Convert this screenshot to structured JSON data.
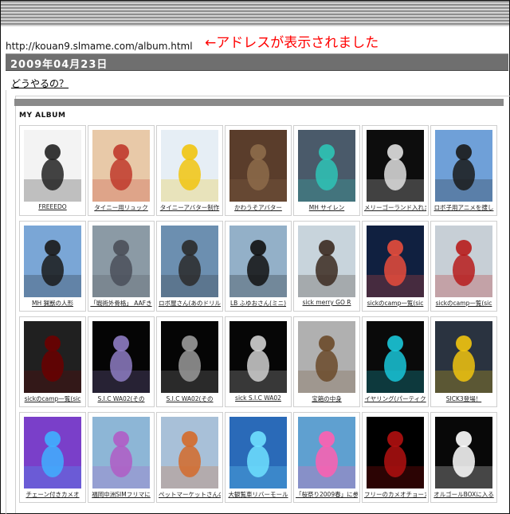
{
  "page": {
    "url": "http://kouan9.slmame.com/album.html",
    "annotation": "←アドレスが表示されました",
    "date": "2009年04月23日",
    "howto_link": "どうやるの？",
    "album_title": "MY ALBUM"
  },
  "album": {
    "rows": [
      [
        {
          "caption": "FREEEDO",
          "bg": "#f3f3f3",
          "accent": "#222222"
        },
        {
          "caption": "タイニー用リュック",
          "bg": "#e8c9a8",
          "accent": "#c0392b"
        },
        {
          "caption": "タイニーアバター制作",
          "bg": "#e6eef5",
          "accent": "#f1c40f"
        },
        {
          "caption": "かわうそアバター",
          "bg": "#5a3d2b",
          "accent": "#8d6b4a"
        },
        {
          "caption": "MH サイレン",
          "bg": "#4a5a6a",
          "accent": "#2ec4b6"
        },
        {
          "caption": "メリーゴーランド入れま",
          "bg": "#0d0d0d",
          "accent": "#e0e0e0"
        },
        {
          "caption": "ロボ子用アニメを捜し",
          "bg": "#6fa0d8",
          "accent": "#1a1a1a"
        }
      ],
      [
        {
          "caption": "MH 猟獣の人形",
          "bg": "#7aa6d6",
          "accent": "#1a1a1a"
        },
        {
          "caption": "「戦術外骨格」 AAFき",
          "bg": "#8b9aa5",
          "accent": "#4a4f59"
        },
        {
          "caption": "ロボ屋さん(あのドリル",
          "bg": "#6c8fb0",
          "accent": "#2a2a2a"
        },
        {
          "caption": "LB ふゆおさん(ミニ)",
          "bg": "#93b0c8",
          "accent": "#111111"
        },
        {
          "caption": "sick merry GO R",
          "bg": "#c8d4dc",
          "accent": "#3b2a20"
        },
        {
          "caption": "sickのcamp一覧(sic",
          "bg": "#102040",
          "accent": "#e74c3c"
        },
        {
          "caption": "sickのcamp一覧(sic",
          "bg": "#c7cfd6",
          "accent": "#b71c1c"
        }
      ],
      [
        {
          "caption": "sickのcamp一覧(sic",
          "bg": "#202020",
          "accent": "#6b0000"
        },
        {
          "caption": "S.I.C WA02(その",
          "bg": "#050505",
          "accent": "#8e7cc3"
        },
        {
          "caption": "S.I.C WA02(その",
          "bg": "#050505",
          "accent": "#9a9a9a"
        },
        {
          "caption": "sick S.I.C WA02",
          "bg": "#060606",
          "accent": "#d0d0d0"
        },
        {
          "caption": "宝箱の中身",
          "bg": "#b0b0b0",
          "accent": "#6b4a2a"
        },
        {
          "caption": "イヤリング(パーティク",
          "bg": "#0a0a0a",
          "accent": "#19c6d8"
        },
        {
          "caption": "SICK3登場！",
          "bg": "#2a3340",
          "accent": "#f1c40f"
        }
      ],
      [
        {
          "caption": "チェーン付きカメオ",
          "bg": "#7a3fc9",
          "accent": "#3fb0ff"
        },
        {
          "caption": "福岡中洲SIMフリマに",
          "bg": "#8db6d6",
          "accent": "#b05cc6"
        },
        {
          "caption": "ペットマーケットさんの",
          "bg": "#a8c0d8",
          "accent": "#d46a2a"
        },
        {
          "caption": "大観覧車リバーモール",
          "bg": "#2a6ab8",
          "accent": "#6fe0ff"
        },
        {
          "caption": "「桜祭り2009春」に参",
          "bg": "#5fa0d0",
          "accent": "#ff5fb0"
        },
        {
          "caption": "フリーのカメオチョーカ",
          "bg": "#000000",
          "accent": "#b01010"
        },
        {
          "caption": "オルゴールBOXに入る",
          "bg": "#080808",
          "accent": "#ffffff"
        }
      ]
    ]
  }
}
